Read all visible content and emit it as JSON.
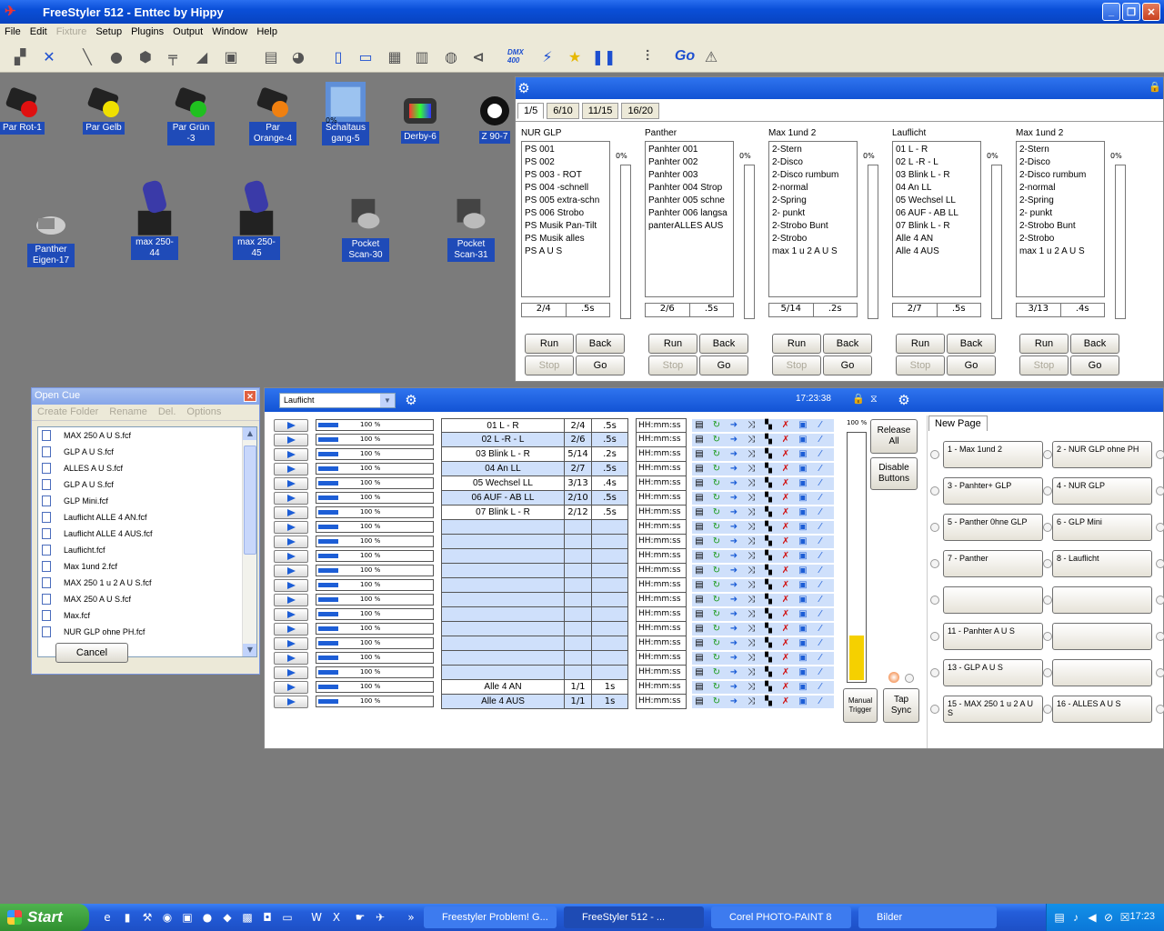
{
  "app": {
    "title": "FreeStyler 512 - Enttec by Hippy"
  },
  "menu": [
    {
      "label": "File",
      "enabled": true
    },
    {
      "label": "Edit",
      "enabled": true
    },
    {
      "label": "Fixture",
      "enabled": false
    },
    {
      "label": "Setup",
      "enabled": true
    },
    {
      "label": "Plugins",
      "enabled": true
    },
    {
      "label": "Output",
      "enabled": true
    },
    {
      "label": "Window",
      "enabled": true
    },
    {
      "label": "Help",
      "enabled": true
    }
  ],
  "toolbar": {
    "dmx_label": "DMX 400",
    "go_label": "Go"
  },
  "fixtures": [
    {
      "label": "Par Rot-1",
      "color": "#e01010"
    },
    {
      "label": "Par Gelb",
      "color": "#f0e000"
    },
    {
      "label": "Par Grün -3",
      "color": "#20c020"
    },
    {
      "label": "Par Orange-4",
      "color": "#f08010"
    },
    {
      "label": "Schaltaus gang-5",
      "badge": "0%",
      "color": "#4a7fd0"
    },
    {
      "label": "Derby-6",
      "color": "#c84040"
    },
    {
      "label": "Z 90-7",
      "color": "#ffffff"
    },
    {
      "label": "Panther Eigen-17",
      "color": "#cccccc"
    },
    {
      "label": "max 250- 44",
      "color": "#3333aa"
    },
    {
      "label": "max 250- 45",
      "color": "#3333aa"
    },
    {
      "label": "Pocket Scan-30",
      "color": "#999999"
    },
    {
      "label": "Pocket Scan-31",
      "color": "#999999"
    }
  ],
  "cuelist": {
    "tabs": [
      "1/5",
      "6/10",
      "11/15",
      "16/20"
    ],
    "groups": [
      {
        "name": "NUR GLP",
        "items": [
          "PS 001",
          "PS 002",
          "PS 003 - ROT",
          "PS 004 -schnell",
          "PS 005 extra-schn",
          "PS 006 Strobo",
          "PS Musik Pan-Tilt",
          "PS Musik alles",
          "PS A U S"
        ],
        "pct": "0%",
        "counter": "2/4",
        "speed": ".5s"
      },
      {
        "name": "Panther",
        "items": [
          "Panhter 001",
          "Panhter 002",
          "Panhter 003",
          "Panhter 004 Strop",
          "Panhter 005 schne",
          "Panhter 006 langsa",
          "panterALLES AUS"
        ],
        "pct": "0%",
        "counter": "2/6",
        "speed": ".5s"
      },
      {
        "name": "Max 1und 2",
        "items": [
          "2-Stern",
          "2-Disco",
          "2-Disco rumbum",
          "2-normal",
          "2-Spring",
          "2- punkt",
          "2-Strobo Bunt",
          "2-Strobo",
          "max 1 u 2 A U S"
        ],
        "pct": "0%",
        "counter": "5/14",
        "speed": ".2s"
      },
      {
        "name": "Lauflicht",
        "items": [
          "01 L - R",
          "02 L -R - L",
          "03 Blink L - R",
          "04 An LL",
          "05 Wechsel LL",
          "06 AUF - AB LL",
          "07 Blink L - R",
          "Alle 4 AN",
          "Alle 4 AUS"
        ],
        "pct": "0%",
        "counter": "2/7",
        "speed": ".5s"
      },
      {
        "name": "Max 1und 2",
        "items": [
          " 2-Stern",
          "2-Disco",
          "2-Disco rumbum",
          "2-normal",
          "2-Spring",
          "2- punkt",
          "2-Strobo Bunt",
          "2-Strobo",
          "max 1 u 2 A U S"
        ],
        "pct": "0%",
        "counter": "3/13",
        "speed": ".4s"
      }
    ],
    "buttons": {
      "run": "Run",
      "back": "Back",
      "stop": "Stop",
      "go": "Go"
    }
  },
  "opencue": {
    "title": "Open Cue",
    "menu": [
      "Create Folder",
      "Rename",
      "Del.",
      "Options"
    ],
    "files": [
      "MAX 250 A U S.fcf",
      "GLP A U S.fcf",
      "ALLES A U S.fcf",
      "GLP A U S.fcf",
      "GLP Mini.fcf",
      "Lauflicht ALLE 4 AN.fcf",
      "Lauflicht ALLE 4 AUS.fcf",
      "Lauflicht.fcf",
      "Max 1und 2.fcf",
      "MAX 250 1 u 2 A U S.fcf",
      "MAX 250 A U S.fcf",
      "Max.fcf",
      "NUR GLP ohne PH.fcf"
    ],
    "cancel": "Cancel"
  },
  "cuegrid": {
    "selected_cue": "Lauflicht",
    "clock": "17:23:38",
    "master_pct": "100 %",
    "master_level": 0.18,
    "time_placeholder": "HH:mm:ss",
    "rows": [
      {
        "level": "100 %",
        "name": "01 L - R",
        "t1": "2/4",
        "t2": ".5s"
      },
      {
        "level": "100 %",
        "name": "02 L -R - L",
        "t1": "2/6",
        "t2": ".5s"
      },
      {
        "level": "100 %",
        "name": "03 Blink L - R",
        "t1": "5/14",
        "t2": ".2s"
      },
      {
        "level": "100 %",
        "name": "04 An LL",
        "t1": "2/7",
        "t2": ".5s"
      },
      {
        "level": "100 %",
        "name": "05 Wechsel LL",
        "t1": "3/13",
        "t2": ".4s"
      },
      {
        "level": "100 %",
        "name": "06 AUF - AB LL",
        "t1": "2/10",
        "t2": ".5s"
      },
      {
        "level": "100 %",
        "name": "07 Blink L - R",
        "t1": "2/12",
        "t2": ".5s"
      },
      {
        "level": "100 %",
        "name": "",
        "t1": "",
        "t2": ""
      },
      {
        "level": "100 %",
        "name": "",
        "t1": "",
        "t2": ""
      },
      {
        "level": "100 %",
        "name": "",
        "t1": "",
        "t2": ""
      },
      {
        "level": "100 %",
        "name": "",
        "t1": "",
        "t2": ""
      },
      {
        "level": "100 %",
        "name": "",
        "t1": "",
        "t2": ""
      },
      {
        "level": "100 %",
        "name": "",
        "t1": "",
        "t2": ""
      },
      {
        "level": "100 %",
        "name": "",
        "t1": "",
        "t2": ""
      },
      {
        "level": "100 %",
        "name": "",
        "t1": "",
        "t2": ""
      },
      {
        "level": "100 %",
        "name": "",
        "t1": "",
        "t2": ""
      },
      {
        "level": "100 %",
        "name": "",
        "t1": "",
        "t2": ""
      },
      {
        "level": "100 %",
        "name": "",
        "t1": "",
        "t2": ""
      },
      {
        "level": "100 %",
        "name": "Alle 4 AN",
        "t1": "1/1",
        "t2": "1s"
      },
      {
        "level": "100 %",
        "name": "Alle 4 AUS",
        "t1": "1/1",
        "t2": "1s"
      }
    ],
    "release_all": "Release All",
    "disable_buttons": "Disable Buttons",
    "manual_trigger": "Manual Trigger",
    "tap_sync": "Tap Sync",
    "page_tab": "New Page",
    "page_buttons": [
      "1 - Max 1und 2",
      "2 - NUR GLP ohne PH",
      "3 - Panhter+ GLP",
      "4 - NUR GLP",
      "5 - Panther 0hne GLP",
      "6 - GLP Mini",
      "7 - Panther",
      "8 - Lauflicht",
      "",
      "",
      "11 - Panhter A U S",
      "",
      "13 - GLP A U S",
      "",
      "15 - MAX 250 1 u 2 A U S",
      "16 - ALLES A U S"
    ]
  },
  "taskbar": {
    "start": "Start",
    "tasks": [
      "Freestyler Problem! G...",
      "FreeStyler 512 - ...",
      "Corel PHOTO-PAINT 8",
      "Bilder"
    ],
    "time": "17:23"
  }
}
